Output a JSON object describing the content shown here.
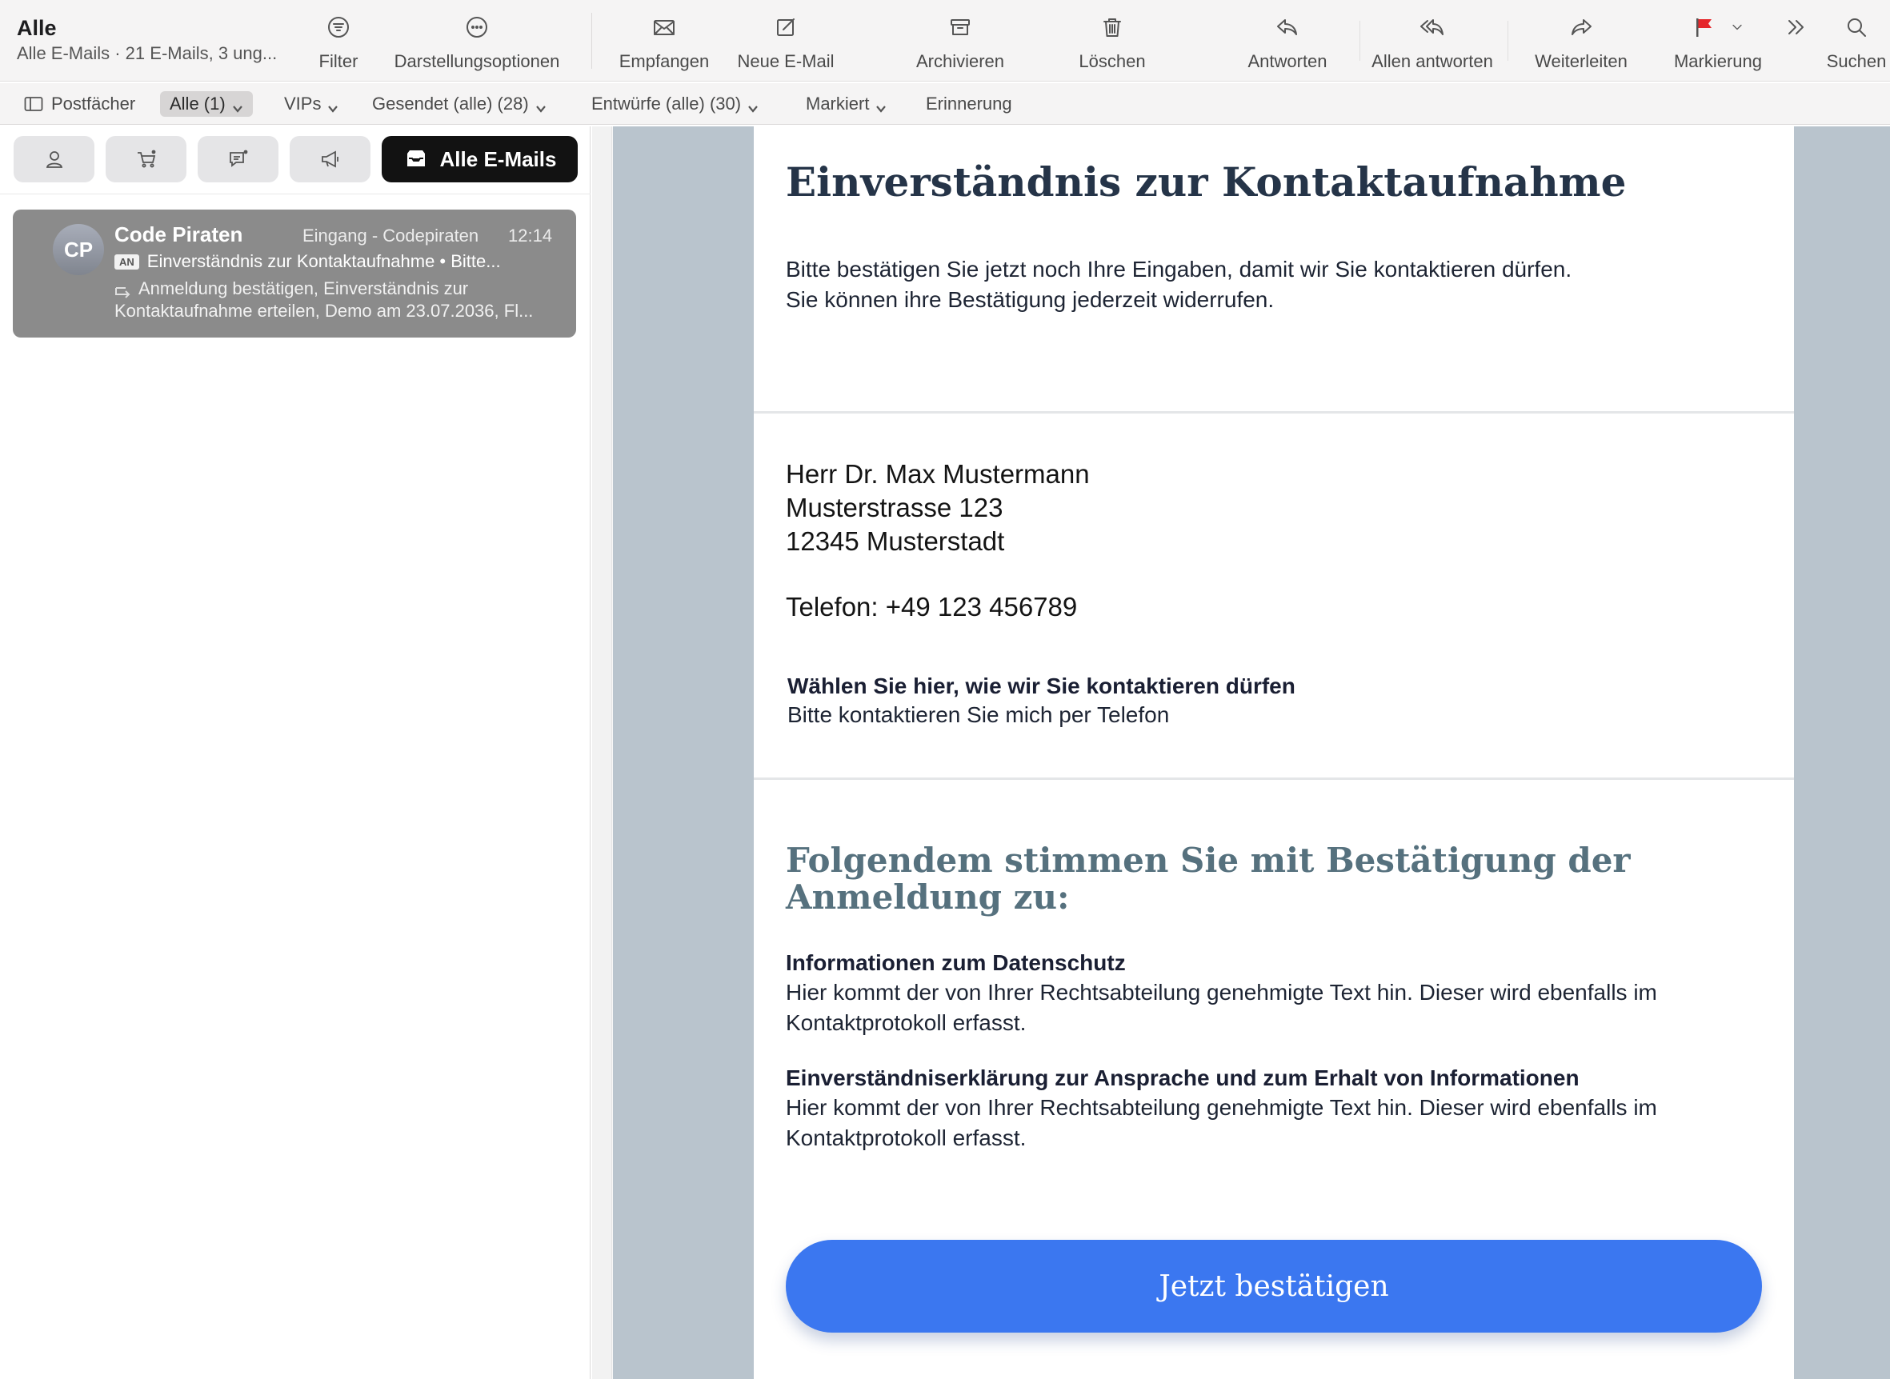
{
  "mailbox": {
    "title": "Alle",
    "subtitle": "Alle E-Mails · 21 E-Mails, 3 ung..."
  },
  "toolbar": {
    "filter": "Filter",
    "view_options": "Darstellungsoptionen",
    "receive": "Empfangen",
    "new_mail": "Neue E-Mail",
    "archive": "Archivieren",
    "delete": "Löschen",
    "reply": "Antworten",
    "reply_all": "Allen antworten",
    "forward": "Weiterleiten",
    "flag": "Markierung",
    "search": "Suchen"
  },
  "favorites": {
    "mailboxes": "Postfächer",
    "all": "Alle (1)",
    "vips": "VIPs",
    "sent": "Gesendet (alle) (28)",
    "drafts": "Entwürfe (alle) (30)",
    "flagged": "Markiert",
    "reminder": "Erinnerung"
  },
  "categories": {
    "all_mails": "Alle E-Mails"
  },
  "message": {
    "avatar": "CP",
    "from": "Code Piraten",
    "mailbox": "Eingang - Codepiraten",
    "time": "12:14",
    "badge": "AN",
    "subject": "Einverständnis zur Kontaktaufnahme • Bitte...",
    "preview_line1": "Anmeldung bestätigen, Einverständnis zur",
    "preview_line2": "Kontaktaufnahme erteilen, Demo am 23.07.2036, Fl..."
  },
  "email": {
    "heading": "Einverständnis zur Kontaktaufnahme",
    "intro_line1": "Bitte bestätigen Sie jetzt noch Ihre Eingaben, damit wir Sie kontaktieren dürfen.",
    "intro_line2": "Sie können ihre Bestätigung jederzeit widerrufen.",
    "address_name": "Herr Dr. Max Mustermann",
    "address_street": "Musterstrasse 123",
    "address_city": "12345 Musterstadt",
    "phone": "Telefon: +49 123 456789",
    "choice_heading": "Wählen Sie hier, wie wir Sie kontaktieren dürfen",
    "choice_value": "Bitte kontaktieren Sie mich per Telefon",
    "consent_heading": "Folgendem stimmen Sie mit Bestätigung der Anmeldung zu:",
    "section1_title": "Informationen zum Datenschutz",
    "section1_text": "Hier kommt der von Ihrer Rechtsabteilung genehmigte Text hin. Dieser wird ebenfalls im Kontaktprotokoll erfasst.",
    "section2_title": "Einverständniserklärung zur Ansprache und zum Erhalt von Informationen",
    "section2_text": "Hier kommt der von Ihrer Rechtsabteilung genehmigte Text hin. Dieser wird ebenfalls im Kontaktprotokoll erfasst.",
    "confirm_button": "Jetzt bestätigen"
  },
  "colors": {
    "confirm_button": "#3b77f0",
    "heading": "#253448",
    "consent_heading": "#56717e",
    "flag": "#e5262b"
  }
}
